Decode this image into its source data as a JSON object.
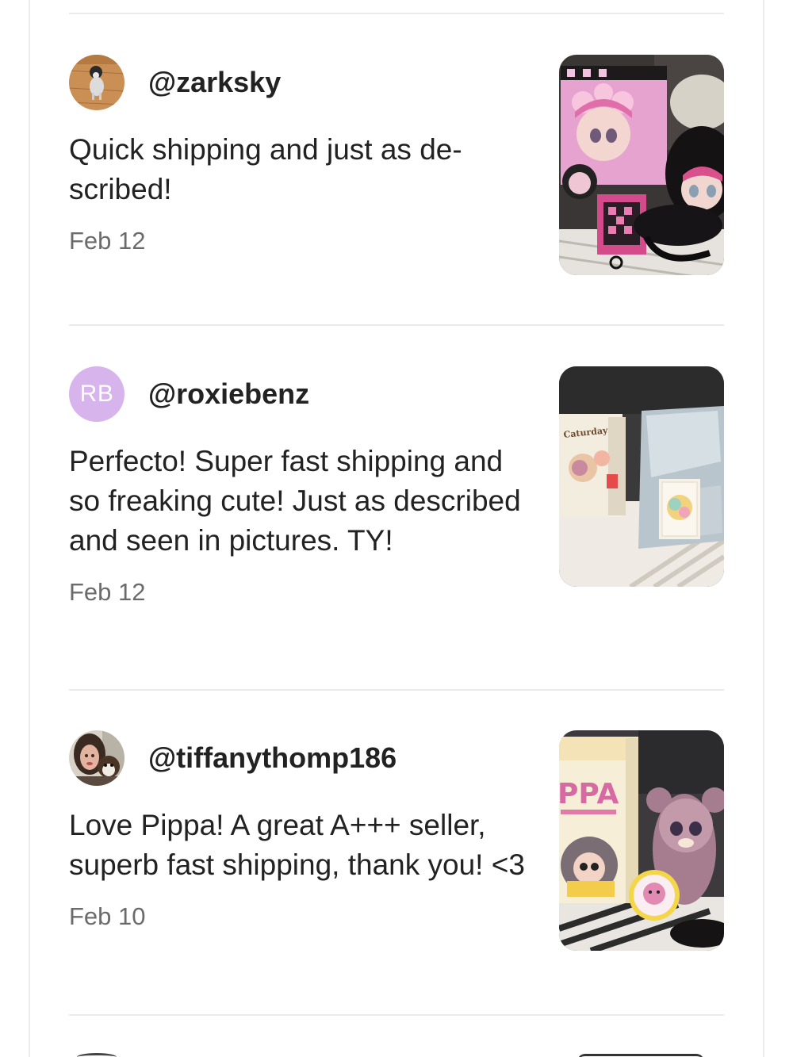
{
  "reviews": [
    {
      "username": "@zarksky",
      "avatar_icon": "dog-photo-avatar",
      "text": "Quick shipping and just as de-scribed!",
      "date": "Feb 12",
      "photo_icon": "pink-doll-figures-photo"
    },
    {
      "username": "@roxiebenz",
      "avatar_initials": "RB",
      "avatar_color": "#d8b4ec",
      "text": "Perfecto! Super fast shipping and so freaking cute! Just as described and seen in pictures. TY!",
      "date": "Feb 12",
      "photo_icon": "blind-box-packages-photo",
      "photo_labels": [
        "Caturday"
      ]
    },
    {
      "username": "@tiffanythomp186",
      "avatar_icon": "person-with-dog-avatar",
      "text": "Love Pippa! A great A+++ seller, superb fast shipping, thank you! <3",
      "date": "Feb 10",
      "photo_icon": "pippa-plush-box-photo",
      "photo_labels": [
        "PPA"
      ]
    }
  ]
}
